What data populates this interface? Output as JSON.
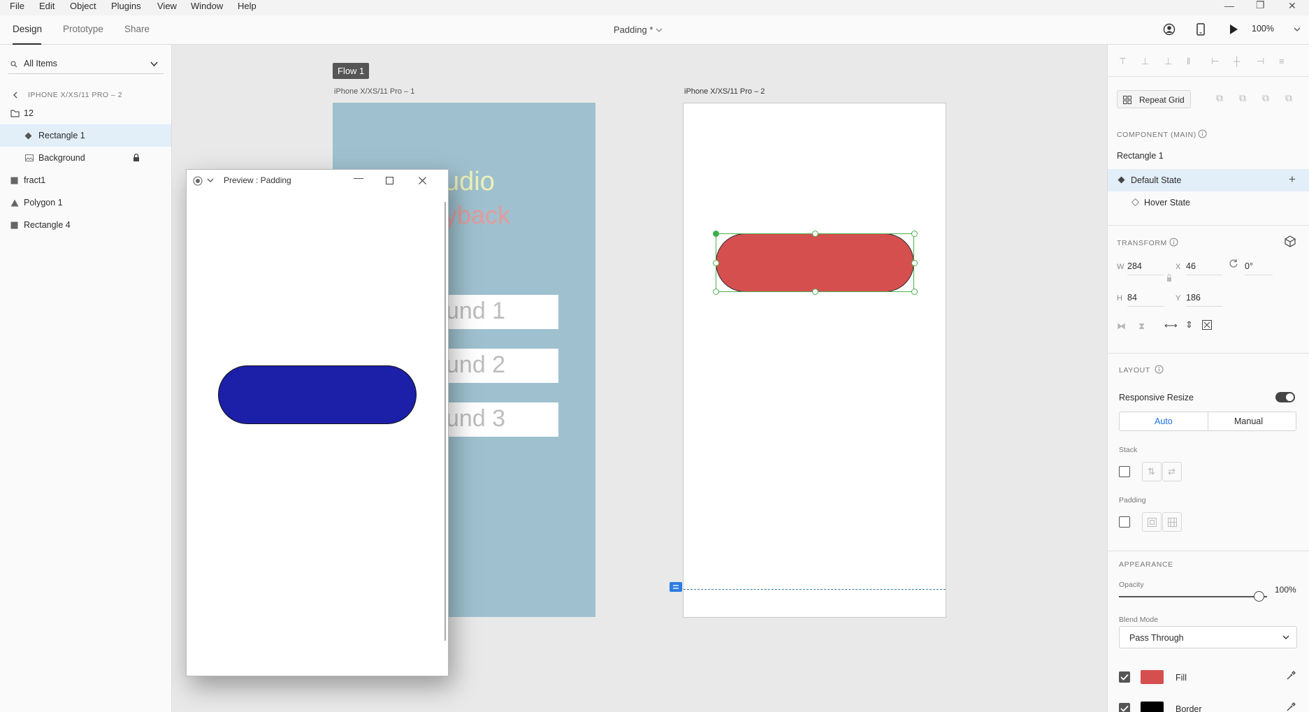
{
  "menubar": {
    "items": [
      "File",
      "Edit",
      "Object",
      "Plugins",
      "View",
      "Window",
      "Help"
    ]
  },
  "tabs": {
    "design": "Design",
    "prototype": "Prototype",
    "share": "Share"
  },
  "document": {
    "title": "Padding *"
  },
  "toolbar": {
    "zoom": "100%"
  },
  "layers": {
    "search_label": "All Items",
    "breadcrumb": "IPHONE X/XS/11 PRO – 2",
    "items": [
      {
        "label": "12",
        "icon": "folder-icon"
      },
      {
        "label": "Rectangle 1",
        "icon": "component-icon",
        "selected": true
      },
      {
        "label": "Background",
        "icon": "image-icon",
        "locked": true
      },
      {
        "label": "fract1",
        "icon": "rectangle-icon"
      },
      {
        "label": "Polygon 1",
        "icon": "triangle-icon"
      },
      {
        "label": "Rectangle 4",
        "icon": "rectangle-icon"
      }
    ]
  },
  "canvas": {
    "flow_label": "Flow 1",
    "artboard1": {
      "name": "iPhone X/XS/11 Pro – 1",
      "bg_color": "#9fc1cf",
      "text1": "udio",
      "text2": "yback",
      "buttons": [
        "und 1",
        "und 2",
        "und 3"
      ]
    },
    "artboard2": {
      "name": "iPhone X/XS/11 Pro – 2",
      "shape_color": "#d64f4f"
    }
  },
  "preview": {
    "title": "Preview : Padding",
    "shape_color": "#1c1fa8"
  },
  "properties": {
    "repeat_grid": "Repeat Grid",
    "component_title": "COMPONENT (MAIN)",
    "component_name": "Rectangle 1",
    "states": [
      "Default State",
      "Hover State"
    ],
    "transform_title": "TRANSFORM",
    "w_label": "W",
    "w": "284",
    "h_label": "H",
    "h": "84",
    "x_label": "X",
    "x": "46",
    "y_label": "Y",
    "y": "186",
    "rotation": "0°",
    "layout_title": "LAYOUT",
    "responsive_resize": "Responsive Resize",
    "auto": "Auto",
    "manual": "Manual",
    "stack": "Stack",
    "padding": "Padding",
    "appearance_title": "APPEARANCE",
    "opacity_label": "Opacity",
    "opacity_value": "100%",
    "blend_label": "Blend Mode",
    "blend_value": "Pass Through",
    "fill_label": "Fill",
    "fill_color": "#d64f4f",
    "border_label": "Border",
    "border_color": "#000000"
  }
}
